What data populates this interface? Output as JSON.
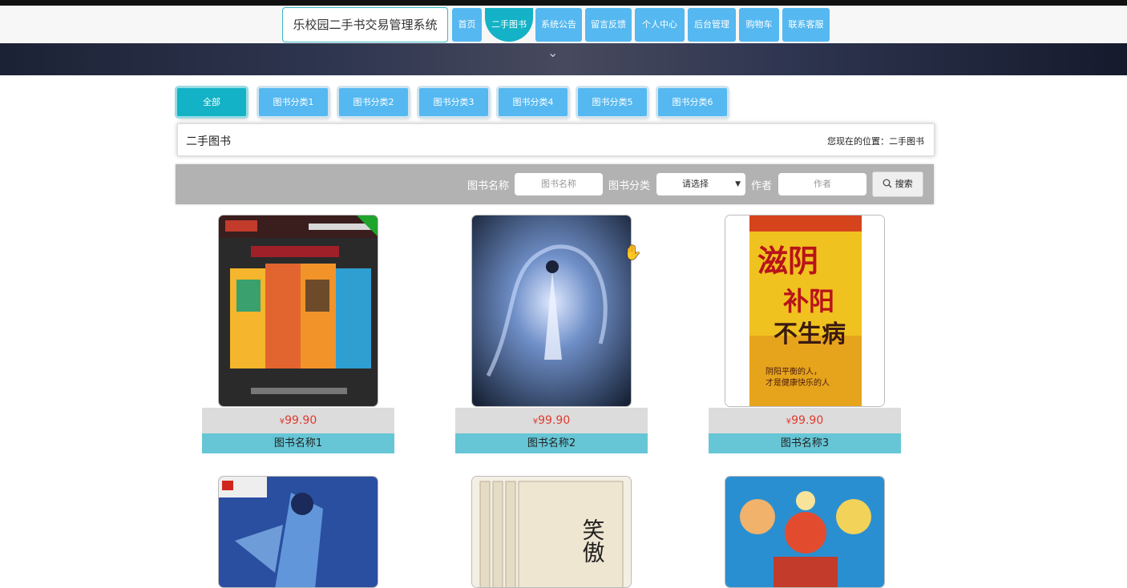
{
  "site": {
    "title": "乐校园二手书交易管理系统"
  },
  "nav": {
    "items": [
      {
        "label": "首页"
      },
      {
        "label": "二手图书"
      },
      {
        "label": "系统公告"
      },
      {
        "label": "留言反馈"
      },
      {
        "label": "个人中心"
      },
      {
        "label": "后台管理"
      },
      {
        "label": "购物车"
      },
      {
        "label": "联系客服"
      }
    ],
    "active": "二手图书"
  },
  "categories": [
    {
      "label": "全部"
    },
    {
      "label": "图书分类1"
    },
    {
      "label": "图书分类2"
    },
    {
      "label": "图书分类3"
    },
    {
      "label": "图书分类4"
    },
    {
      "label": "图书分类5"
    },
    {
      "label": "图书分类6"
    }
  ],
  "breadcrumb": {
    "title": "二手图书",
    "location": "您现在的位置：二手图书"
  },
  "search": {
    "name_label": "图书名称",
    "name_placeholder": "图书名称",
    "category_label": "图书分类",
    "category_value": "请选择",
    "author_label": "作者",
    "author_placeholder": "作者",
    "button_label": "搜索"
  },
  "books": [
    {
      "name": "图书名称1",
      "price": "99.90",
      "currency": "¥"
    },
    {
      "name": "图书名称2",
      "price": "99.90",
      "currency": "¥"
    },
    {
      "name": "图书名称3",
      "price": "99.90",
      "currency": "¥"
    },
    {
      "name": "",
      "price": "",
      "currency": ""
    },
    {
      "name": "",
      "price": "",
      "currency": ""
    },
    {
      "name": "",
      "price": "",
      "currency": ""
    }
  ],
  "cover_texts": {
    "book3_title": "滋阴",
    "book3_subtitle": "补阳",
    "book3_line": "不生病",
    "book3_tagline1": "阴阳平衡的人，",
    "book3_tagline2": "才是健康快乐的人",
    "book5_title": "笑傲"
  },
  "colors": {
    "accent": "#13b2c6",
    "nav_blue": "#55b8f0",
    "price_red": "#e03a2f",
    "name_bar": "#66c6d6"
  }
}
